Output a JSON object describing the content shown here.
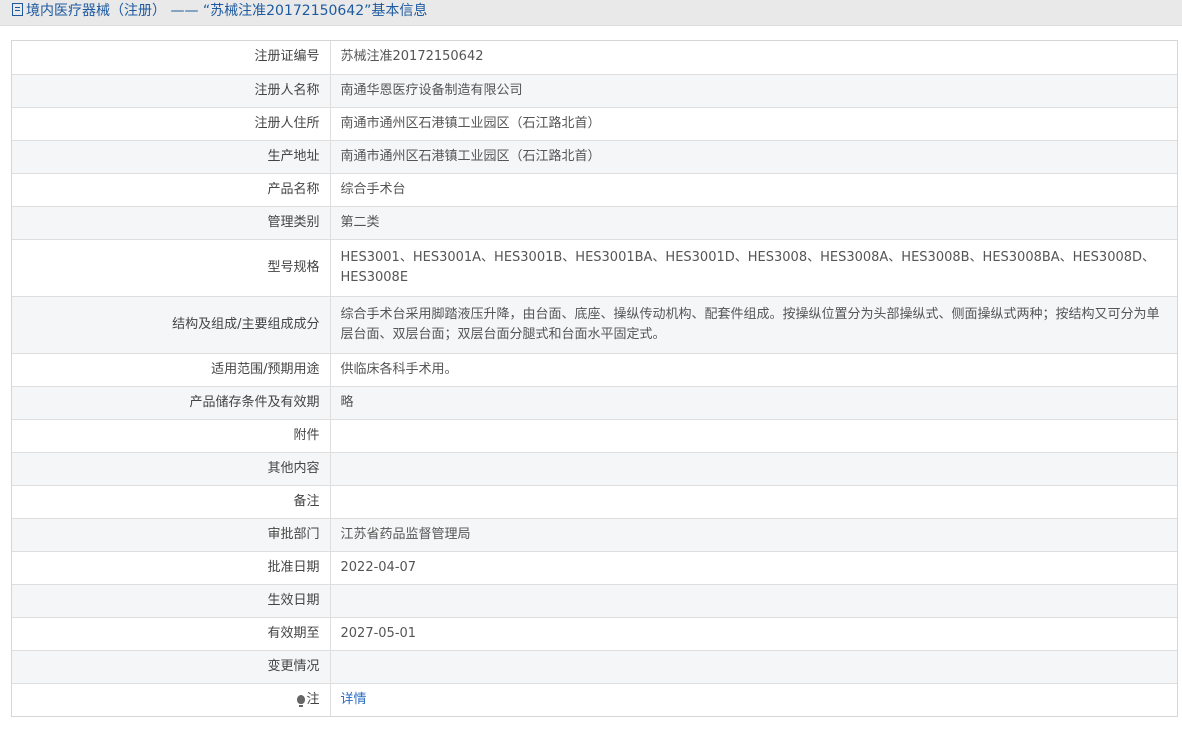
{
  "page": {
    "title": "境内医疗器械（注册） —— “苏械注准20172150642”基本信息"
  },
  "rows": [
    {
      "label": "注册证编号",
      "value": "苏械注准20172150642"
    },
    {
      "label": "注册人名称",
      "value": "南通华恩医疗设备制造有限公司"
    },
    {
      "label": "注册人住所",
      "value": "南通市通州区石港镇工业园区（石江路北首）"
    },
    {
      "label": "生产地址",
      "value": "南通市通州区石港镇工业园区（石江路北首）"
    },
    {
      "label": "产品名称",
      "value": "综合手术台"
    },
    {
      "label": "管理类别",
      "value": "第二类"
    },
    {
      "label": "型号规格",
      "value": "HES3001、HES3001A、HES3001B、HES3001BA、HES3001D、HES3008、HES3008A、HES3008B、HES3008BA、HES3008D、HES3008E"
    },
    {
      "label": "结构及组成/主要组成成分",
      "value": "综合手术台采用脚踏液压升降，由台面、底座、操纵传动机构、配套件组成。按操纵位置分为头部操纵式、侧面操纵式两种；按结构又可分为单层台面、双层台面；双层台面分腿式和台面水平固定式。"
    },
    {
      "label": "适用范围/预期用途",
      "value": "供临床各科手术用。"
    },
    {
      "label": "产品储存条件及有效期",
      "value": "略"
    },
    {
      "label": "附件",
      "value": ""
    },
    {
      "label": "其他内容",
      "value": ""
    },
    {
      "label": "备注",
      "value": ""
    },
    {
      "label": "审批部门",
      "value": "江苏省药品监督管理局"
    },
    {
      "label": "批准日期",
      "value": "2022-04-07"
    },
    {
      "label": "生效日期",
      "value": ""
    },
    {
      "label": "有效期至",
      "value": "2027-05-01"
    },
    {
      "label": "变更情况",
      "value": ""
    },
    {
      "label": "注",
      "value": "详情"
    }
  ],
  "icons": {
    "title_icon": "document-icon",
    "note_icon": "lightbulb-icon"
  },
  "colors": {
    "title_text": "#1e5aa0",
    "link": "#2a6ac2",
    "stripe": "#f5f6f7",
    "header_bg": "#e9e9e9"
  }
}
